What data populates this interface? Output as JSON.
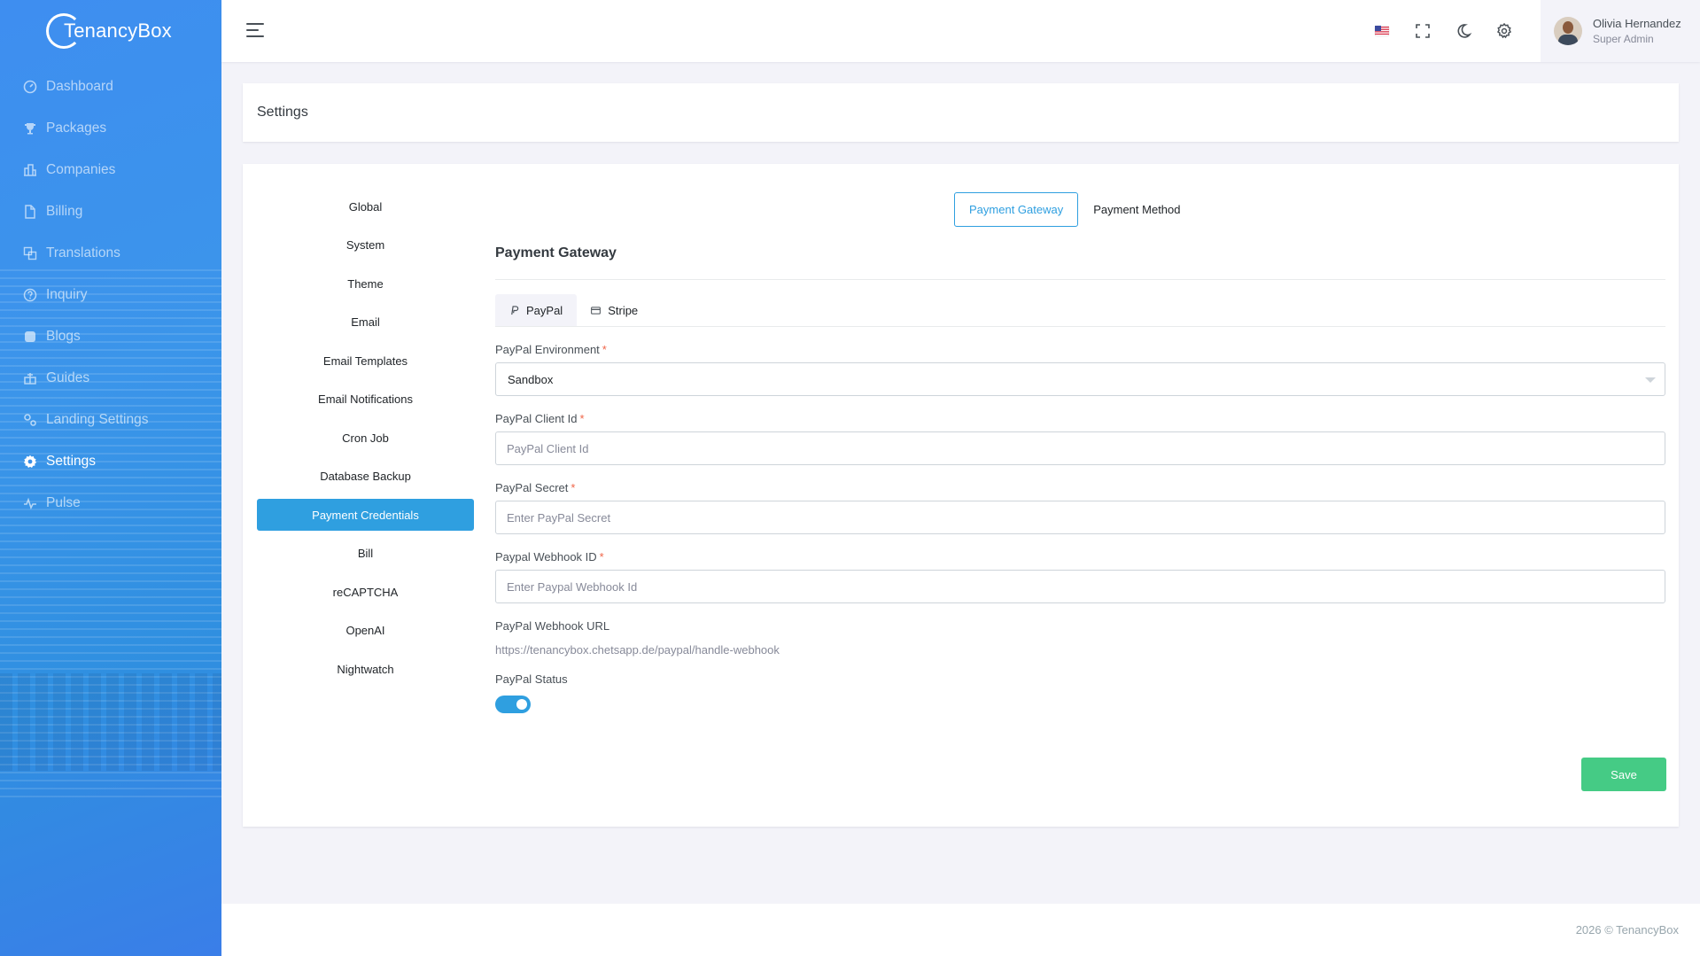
{
  "app": {
    "name": "TenancyBox"
  },
  "sidebar": {
    "items": [
      {
        "label": "Dashboard",
        "icon": "dashboard-icon",
        "active": false
      },
      {
        "label": "Packages",
        "icon": "trophy-icon",
        "active": false
      },
      {
        "label": "Companies",
        "icon": "building-icon",
        "active": false
      },
      {
        "label": "Billing",
        "icon": "file-icon",
        "active": false
      },
      {
        "label": "Translations",
        "icon": "translate-icon",
        "active": false
      },
      {
        "label": "Inquiry",
        "icon": "question-icon",
        "active": false
      },
      {
        "label": "Blogs",
        "icon": "blog-icon",
        "active": false
      },
      {
        "label": "Guides",
        "icon": "guide-icon",
        "active": false
      },
      {
        "label": "Landing Settings",
        "icon": "gears-icon",
        "active": false
      },
      {
        "label": "Settings",
        "icon": "gear-icon",
        "active": true
      },
      {
        "label": "Pulse",
        "icon": "pulse-icon",
        "active": false
      }
    ]
  },
  "topbar": {
    "icons": [
      "us-flag-icon",
      "fullscreen-icon",
      "moon-icon",
      "gear-icon"
    ],
    "user": {
      "name": "Olivia Hernandez",
      "role": "Super Admin"
    }
  },
  "page": {
    "title": "Settings"
  },
  "settings_nav": {
    "items": [
      {
        "label": "Global",
        "active": false
      },
      {
        "label": "System",
        "active": false
      },
      {
        "label": "Theme",
        "active": false
      },
      {
        "label": "Email",
        "active": false
      },
      {
        "label": "Email Templates",
        "active": false
      },
      {
        "label": "Email Notifications",
        "active": false
      },
      {
        "label": "Cron Job",
        "active": false
      },
      {
        "label": "Database Backup",
        "active": false
      },
      {
        "label": "Payment Credentials",
        "active": true
      },
      {
        "label": "Bill",
        "active": false
      },
      {
        "label": "reCAPTCHA",
        "active": false
      },
      {
        "label": "OpenAI",
        "active": false
      },
      {
        "label": "Nightwatch",
        "active": false
      }
    ]
  },
  "gateway_tabs": [
    {
      "label": "Payment Gateway",
      "active": true
    },
    {
      "label": "Payment Method",
      "active": false
    }
  ],
  "section": {
    "title": "Payment Gateway"
  },
  "provider_tabs": [
    {
      "label": "PayPal",
      "icon": "paypal-icon",
      "active": true
    },
    {
      "label": "Stripe",
      "icon": "card-icon",
      "active": false
    }
  ],
  "form": {
    "environment": {
      "label": "PayPal Environment",
      "value": "Sandbox"
    },
    "client_id": {
      "label": "PayPal Client Id",
      "placeholder": "PayPal Client Id"
    },
    "secret": {
      "label": "PayPal Secret",
      "placeholder": "Enter PayPal Secret"
    },
    "webhook_id": {
      "label": "Paypal Webhook ID",
      "placeholder": "Enter Paypal Webhook Id"
    },
    "webhook_url": {
      "label": "PayPal Webhook URL",
      "value": "https://tenancybox.chetsapp.de/paypal/handle-webhook"
    },
    "status": {
      "label": "PayPal Status",
      "enabled": true
    },
    "required_mark": "*",
    "save_label": "Save"
  },
  "footer": {
    "text": "2026 © TenancyBox"
  },
  "colors": {
    "primary": "#2f9fe0",
    "success": "#45cb85",
    "danger": "#f06548"
  }
}
